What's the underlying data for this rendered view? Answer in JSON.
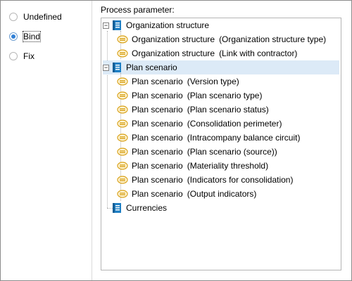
{
  "binding_modes": {
    "options": [
      {
        "label": "Undefined",
        "checked": false
      },
      {
        "label": "Bind",
        "checked": true
      },
      {
        "label": "Fix",
        "checked": false
      }
    ]
  },
  "parameter_panel": {
    "label": "Process parameter:",
    "tree": [
      {
        "label": "Organization structure",
        "expanded": true,
        "children": [
          {
            "label": "Organization structure",
            "suffix": "(Organization structure type)"
          },
          {
            "label": "Organization structure",
            "suffix": "(Link with contractor)"
          }
        ]
      },
      {
        "label": "Plan scenario",
        "expanded": true,
        "selected": true,
        "children": [
          {
            "label": "Plan scenario",
            "suffix": "(Version type)"
          },
          {
            "label": "Plan scenario",
            "suffix": "(Plan scenario type)"
          },
          {
            "label": "Plan scenario",
            "suffix": "(Plan scenario status)"
          },
          {
            "label": "Plan scenario",
            "suffix": "(Consolidation perimeter)"
          },
          {
            "label": "Plan scenario",
            "suffix": "(Intracompany balance circuit)"
          },
          {
            "label": "Plan scenario",
            "suffix": "(Plan scenario (source))"
          },
          {
            "label": "Plan scenario",
            "suffix": "(Materiality threshold)"
          },
          {
            "label": "Plan scenario",
            "suffix": "(Indicators for consolidation)"
          },
          {
            "label": "Plan scenario",
            "suffix": "(Output indicators)"
          }
        ]
      },
      {
        "label": "Currencies",
        "expanded": false,
        "children": []
      }
    ]
  },
  "icons": {
    "dictionary": "dictionary-icon",
    "attribute": "attribute-link-icon",
    "expand_toggle": "minus-box-icon"
  },
  "colors": {
    "dictionary_icon": "#1e7fc4",
    "attribute_icon": "#d9a21b",
    "selection": "#dceaf7",
    "radio_checked": "#2f7fd6"
  }
}
